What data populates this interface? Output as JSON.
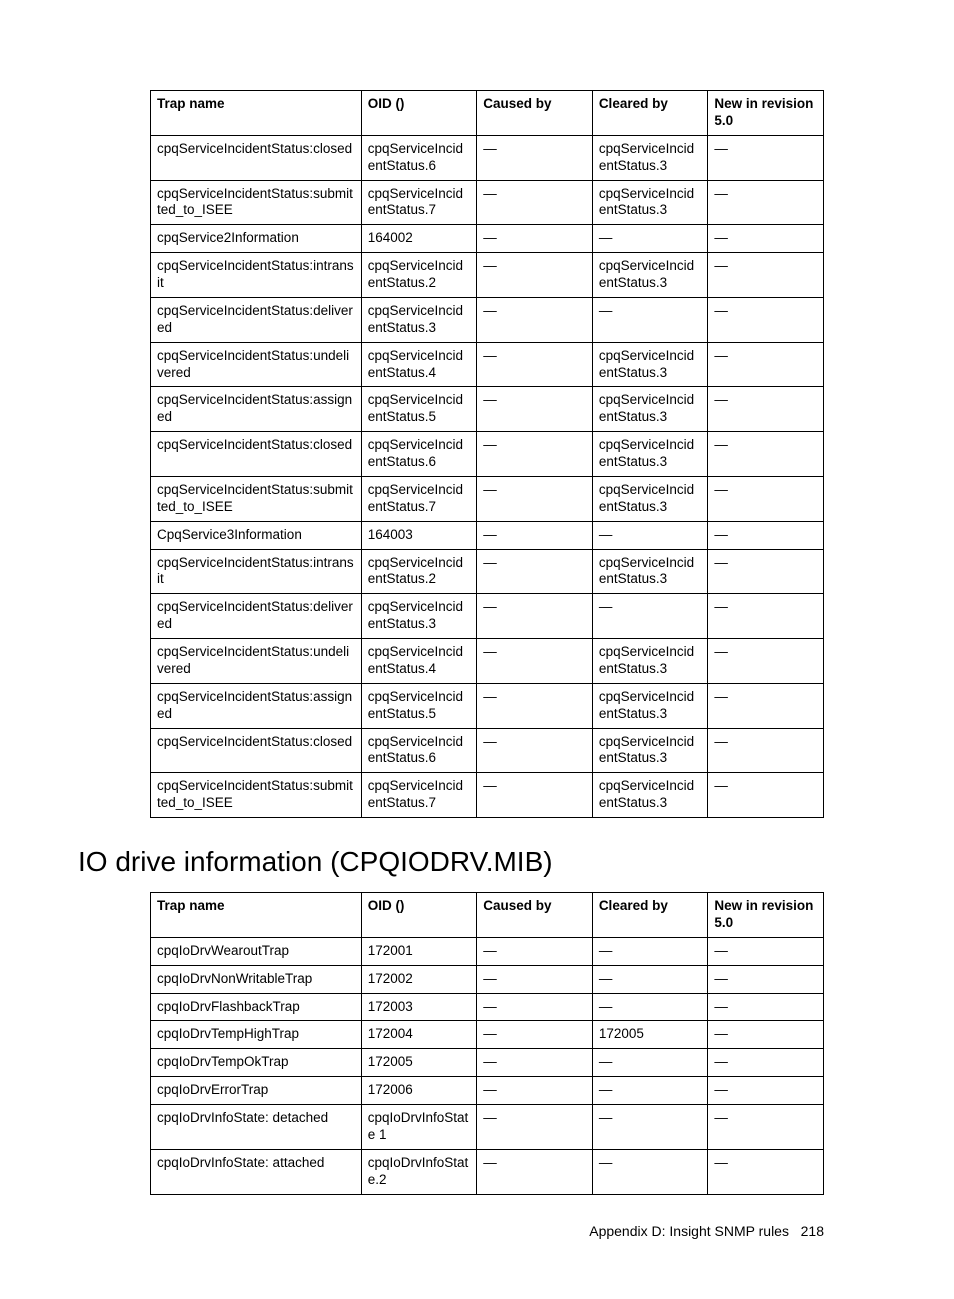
{
  "headers": {
    "trap": "Trap name",
    "oid": "OID ()",
    "caused": "Caused by",
    "cleared": "Cleared by",
    "newin": "New in revision 5.0"
  },
  "dash": "—",
  "table1": [
    {
      "trap": "cpqServiceIncidentStatus:closed",
      "oid": "cpqServiceIncidentStatus.6",
      "caused": "—",
      "cleared": "cpqServiceIncidentStatus.3",
      "newin": "—"
    },
    {
      "trap": "cpqServiceIncidentStatus:submitted_to_ISEE",
      "oid": "cpqServiceIncidentStatus.7",
      "caused": "—",
      "cleared": "cpqServiceIncidentStatus.3",
      "newin": "—"
    },
    {
      "trap": "cpqService2Information",
      "oid": "164002",
      "caused": "—",
      "cleared": "—",
      "newin": "—"
    },
    {
      "trap": "cpqServiceIncidentStatus:intransit",
      "oid": "cpqServiceIncidentStatus.2",
      "caused": "—",
      "cleared": "cpqServiceIncidentStatus.3",
      "newin": "—"
    },
    {
      "trap": "cpqServiceIncidentStatus:delivered",
      "oid": "cpqServiceIncidentStatus.3",
      "caused": "—",
      "cleared": "—",
      "newin": "—"
    },
    {
      "trap": "cpqServiceIncidentStatus:undelivered",
      "oid": "cpqServiceIncidentStatus.4",
      "caused": "—",
      "cleared": "cpqServiceIncidentStatus.3",
      "newin": "—"
    },
    {
      "trap": "cpqServiceIncidentStatus:assigned",
      "oid": "cpqServiceIncidentStatus.5",
      "caused": "—",
      "cleared": "cpqServiceIncidentStatus.3",
      "newin": "—"
    },
    {
      "trap": "cpqServiceIncidentStatus:closed",
      "oid": "cpqServiceIncidentStatus.6",
      "caused": "—",
      "cleared": "cpqServiceIncidentStatus.3",
      "newin": "—"
    },
    {
      "trap": "cpqServiceIncidentStatus:submitted_to_ISEE",
      "oid": "cpqServiceIncidentStatus.7",
      "caused": "—",
      "cleared": "cpqServiceIncidentStatus.3",
      "newin": "—"
    },
    {
      "trap": "CpqService3Information",
      "oid": "164003",
      "caused": "—",
      "cleared": "—",
      "newin": "—"
    },
    {
      "trap": "cpqServiceIncidentStatus:intransit",
      "oid": "cpqServiceIncidentStatus.2",
      "caused": "—",
      "cleared": "cpqServiceIncidentStatus.3",
      "newin": "—"
    },
    {
      "trap": "cpqServiceIncidentStatus:delivered",
      "oid": "cpqServiceIncidentStatus.3",
      "caused": "—",
      "cleared": "—",
      "newin": "—"
    },
    {
      "trap": "cpqServiceIncidentStatus:undelivered",
      "oid": "cpqServiceIncidentStatus.4",
      "caused": "—",
      "cleared": "cpqServiceIncidentStatus.3",
      "newin": "—"
    },
    {
      "trap": "cpqServiceIncidentStatus:assigned",
      "oid": "cpqServiceIncidentStatus.5",
      "caused": "—",
      "cleared": "cpqServiceIncidentStatus.3",
      "newin": "—"
    },
    {
      "trap": "cpqServiceIncidentStatus:closed",
      "oid": "cpqServiceIncidentStatus.6",
      "caused": "—",
      "cleared": "cpqServiceIncidentStatus.3",
      "newin": "—"
    },
    {
      "trap": "cpqServiceIncidentStatus:submitted_to_ISEE",
      "oid": "cpqServiceIncidentStatus.7",
      "caused": "—",
      "cleared": "cpqServiceIncidentStatus.3",
      "newin": "—"
    }
  ],
  "section_heading": "IO drive information (CPQIODRV.MIB)",
  "table2": [
    {
      "trap": "cpqIoDrvWearoutTrap",
      "oid": "172001",
      "caused": "—",
      "cleared": "—",
      "newin": "—"
    },
    {
      "trap": "cpqIoDrvNonWritableTrap",
      "oid": "172002",
      "caused": "—",
      "cleared": "—",
      "newin": "—"
    },
    {
      "trap": "cpqIoDrvFlashbackTrap",
      "oid": "172003",
      "caused": "—",
      "cleared": "—",
      "newin": "—"
    },
    {
      "trap": "cpqIoDrvTempHighTrap",
      "oid": "172004",
      "caused": "—",
      "cleared": "172005",
      "newin": "—"
    },
    {
      "trap": "cpqIoDrvTempOkTrap",
      "oid": "172005",
      "caused": "—",
      "cleared": "—",
      "newin": "—"
    },
    {
      "trap": "cpqIoDrvErrorTrap",
      "oid": "172006",
      "caused": "—",
      "cleared": "—",
      "newin": "—"
    },
    {
      "trap": "cpqIoDrvInfoState: detached",
      "oid": "cpqIoDrvInfoState 1",
      "caused": "—",
      "cleared": "—",
      "newin": "—"
    },
    {
      "trap": "cpqIoDrvInfoState: attached",
      "oid": "cpqIoDrvInfoState.2",
      "caused": "—",
      "cleared": "—",
      "newin": "—"
    }
  ],
  "footer": {
    "text": "Appendix D: Insight SNMP rules",
    "page": "218"
  }
}
